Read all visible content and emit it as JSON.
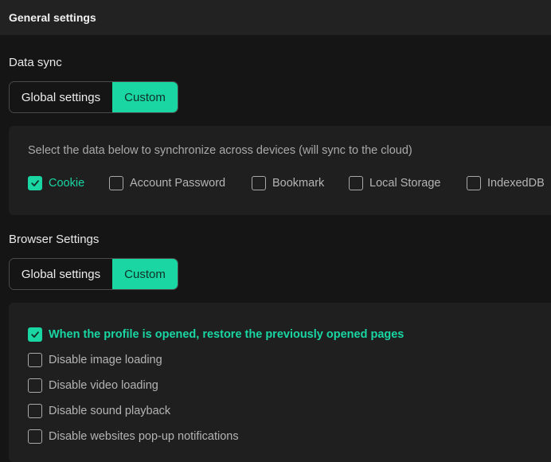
{
  "header": {
    "title": "General settings"
  },
  "data_sync": {
    "title": "Data sync",
    "segment": {
      "global_label": "Global settings",
      "custom_label": "Custom",
      "selected": "Custom"
    },
    "hint": "Select the data below to synchronize across devices (will sync to the cloud)",
    "options": [
      {
        "label": "Cookie",
        "checked": true
      },
      {
        "label": "Account Password",
        "checked": false
      },
      {
        "label": "Bookmark",
        "checked": false
      },
      {
        "label": "Local Storage",
        "checked": false
      },
      {
        "label": "IndexedDB",
        "checked": false
      }
    ]
  },
  "browser_settings": {
    "title": "Browser Settings",
    "segment": {
      "global_label": "Global settings",
      "custom_label": "Custom",
      "selected": "Custom"
    },
    "options": [
      {
        "label": "When the profile is opened, restore the previously opened pages",
        "checked": true
      },
      {
        "label": "Disable image loading",
        "checked": false
      },
      {
        "label": "Disable video loading",
        "checked": false
      },
      {
        "label": "Disable sound playback",
        "checked": false
      },
      {
        "label": "Disable websites pop-up notifications",
        "checked": false
      }
    ]
  },
  "colors": {
    "accent": "#19d6a3",
    "background": "#151515",
    "panel": "#1f1f1f",
    "header": "#222222"
  }
}
